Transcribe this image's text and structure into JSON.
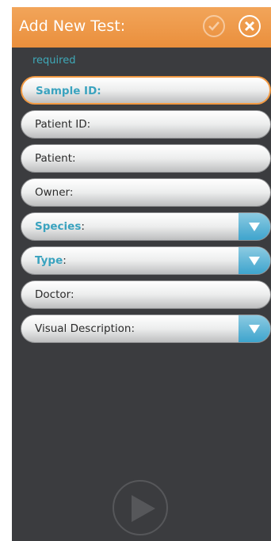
{
  "header": {
    "title": "Add New Test:"
  },
  "form": {
    "required_note": "required",
    "fields": [
      {
        "label": "Sample ID:"
      },
      {
        "label": "Patient ID:"
      },
      {
        "label": "Patient:"
      },
      {
        "label": "Owner:"
      },
      {
        "label": "Species",
        "suffix": ":"
      },
      {
        "label": "Type",
        "suffix": ":"
      },
      {
        "label": "Doctor:"
      },
      {
        "label": "Visual Description:"
      }
    ]
  },
  "icons": {
    "confirm": "checkmark-icon",
    "close": "close-icon",
    "dropdown": "chevron-down-icon",
    "start": "play-icon"
  },
  "colors": {
    "accent": "#ea8f3c",
    "required": "#3aa3bf",
    "panel": "#3b3c3f"
  }
}
